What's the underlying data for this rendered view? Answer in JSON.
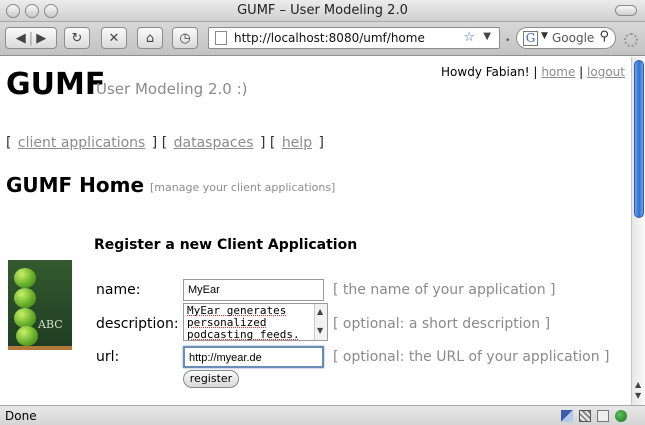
{
  "window": {
    "title": "GUMF – User Modeling 2.0"
  },
  "toolbar": {
    "url": "http://localhost:8080/umf/home",
    "search_placeholder": "Google"
  },
  "page": {
    "logo": "GUMF",
    "subtitle": "User Modeling 2.0 :)",
    "greeting": "Howdy Fabian! |",
    "home_link": "home",
    "sep": "|",
    "logout_link": "logout",
    "nav": {
      "open": "[",
      "client_applications": "client applications",
      "sep1": "] [",
      "dataspaces": "dataspaces",
      "sep2": "] [",
      "help": "help",
      "close": "]"
    },
    "heading": "GUMF Home",
    "heading_sub": "[manage your client applications]",
    "abc_text": "ABC"
  },
  "form": {
    "title": "Register a new Client Application",
    "name_label": "name:",
    "name_value": "MyEar",
    "name_hint": "[ the name of your application ]",
    "description_label": "description:",
    "description_line1": "MyEar generates",
    "description_line2": "personalized",
    "description_line3": "podcasting feeds.",
    "description_hint": "[ optional: a short description ]",
    "url_label": "url:",
    "url_value": "http://myear.de",
    "url_hint": "[ optional: the URL of your application ]",
    "register_label": "register"
  },
  "status": {
    "text": "Done"
  },
  "icons": {
    "back": "back-icon",
    "forward": "forward-icon",
    "reload": "reload-icon",
    "stop": "stop-icon",
    "home": "home-icon",
    "bookmark": "star-icon"
  },
  "colors": {
    "link_gray": "#8c8c8c",
    "scroll_blue": "#2f6fd1",
    "url_focus": "#6c8cb8"
  }
}
